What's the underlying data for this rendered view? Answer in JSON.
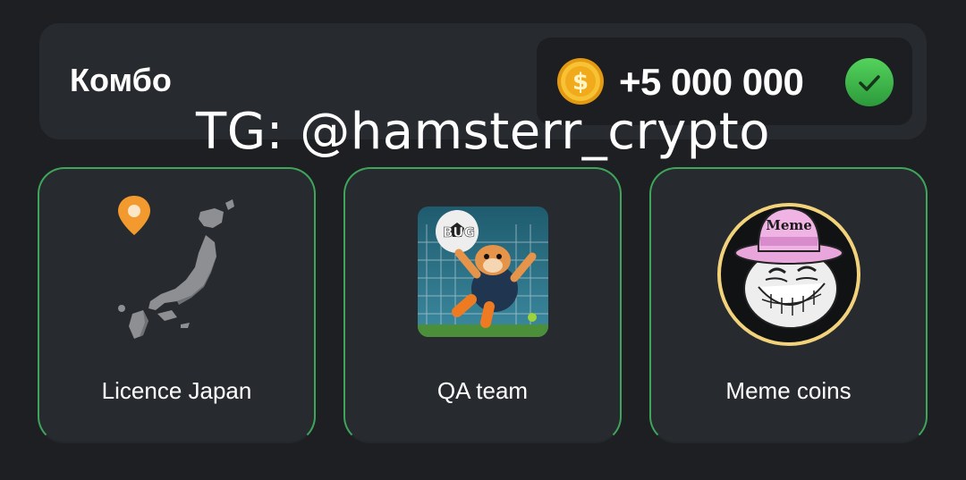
{
  "combo": {
    "title": "Комбо",
    "reward": "+5 000 000",
    "coin_icon": "coin-icon",
    "status_icon": "check-icon",
    "status_color": "#3fbf4f"
  },
  "watermark": "TG: @hamsterr_crypto",
  "cards": [
    {
      "label": "Licence Japan",
      "icon": "japan-map-icon"
    },
    {
      "label": "QA team",
      "icon": "hamster-goalkeeper-image",
      "image_text": "BUG"
    },
    {
      "label": "Meme coins",
      "icon": "troll-face-hat-image",
      "image_text": "Meme"
    }
  ],
  "colors": {
    "background": "#1d1f23",
    "panel": "#272a2f",
    "card_border": "#3fa55a",
    "meme_ring": "#f2d27a",
    "coin": "#f5b82a"
  }
}
